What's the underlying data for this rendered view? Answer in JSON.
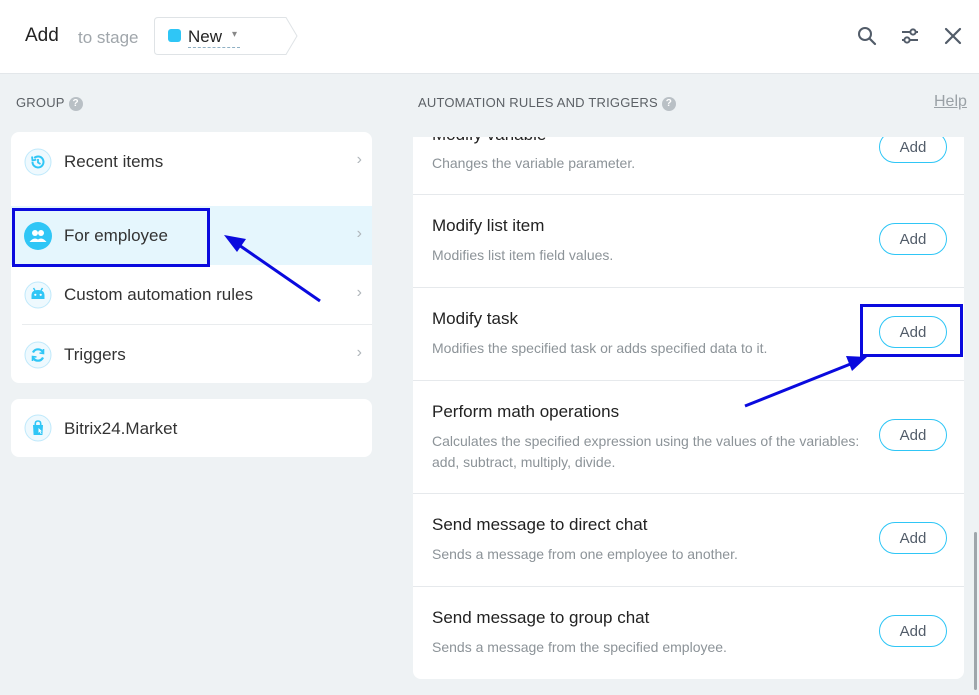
{
  "header": {
    "title": "Add",
    "subtitle": "to stage",
    "stage": {
      "label": "New",
      "color": "#2fc6f6"
    }
  },
  "left": {
    "section_label": "GROUP",
    "groups": [
      {
        "label": "Recent items",
        "icon": "history-icon"
      },
      {
        "label": "For employee",
        "icon": "employee-icon",
        "selected": true
      },
      {
        "label": "Custom automation rules",
        "icon": "android-icon"
      },
      {
        "label": "Triggers",
        "icon": "triggers-icon"
      }
    ],
    "market": {
      "label": "Bitrix24.Market",
      "icon": "market-bag-icon"
    }
  },
  "right": {
    "section_label": "AUTOMATION RULES AND TRIGGERS",
    "help_label": "Help",
    "rules": [
      {
        "title": "Modify variable",
        "description": "Changes the variable parameter.",
        "button": "Add"
      },
      {
        "title": "Modify list item",
        "description": "Modifies list item field values.",
        "button": "Add"
      },
      {
        "title": "Modify task",
        "description": "Modifies the specified task or adds specified data to it.",
        "button": "Add"
      },
      {
        "title": "Perform math operations",
        "description": "Calculates the specified expression using the values of the variables: add, subtract, multiply, divide.",
        "button": "Add"
      },
      {
        "title": "Send message to direct chat",
        "description": "Sends a message from one employee to another.",
        "button": "Add"
      },
      {
        "title": "Send message to group chat",
        "description": "Sends a message from the specified employee.",
        "button": "Add"
      }
    ]
  },
  "colors": {
    "accent": "#2fc6f6",
    "annotation": "#0a0ade",
    "selected_bg": "#e5f6fd"
  }
}
